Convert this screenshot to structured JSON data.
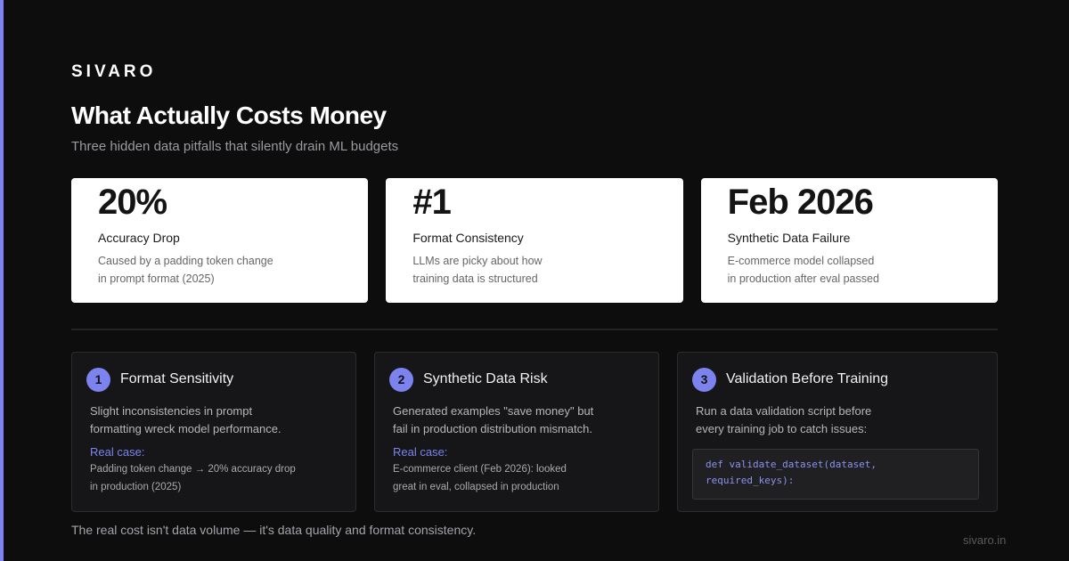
{
  "brand": "SIVARO",
  "title": "What Actually Costs Money",
  "subtitle": "Three hidden data pitfalls that silently drain ML budgets",
  "colors": {
    "background": "#0d0d0e",
    "accent": "#7c83ee",
    "card": "#ffffff"
  },
  "stats": [
    {
      "value": "20%",
      "label": "Accuracy Drop",
      "desc_line1": "Caused by a padding token change",
      "desc_line2": "in prompt format (2025)"
    },
    {
      "value": "#1",
      "label": "Format Consistency",
      "desc_line1": "LLMs are picky about how",
      "desc_line2": "training data is structured"
    },
    {
      "value": "Feb 2026",
      "label": "Synthetic Data Failure",
      "desc_line1": "E-commerce model collapsed",
      "desc_line2": "in production after eval passed"
    }
  ],
  "tips": [
    {
      "number": "1",
      "title": "Format Sensitivity",
      "body_line1": "Slight inconsistencies in prompt",
      "body_line2": "formatting wreck model performance.",
      "case_label": "Real case:",
      "case_line1": "Padding token change → 20% accuracy drop",
      "case_line2": "in production (2025)"
    },
    {
      "number": "2",
      "title": "Synthetic Data Risk",
      "body_line1": "Generated examples \"save money\" but",
      "body_line2": "fail in production distribution mismatch.",
      "case_label": "Real case:",
      "case_line1": "E-commerce client (Feb 2026): looked",
      "case_line2": "great in eval, collapsed in production"
    },
    {
      "number": "3",
      "title": "Validation Before Training",
      "body_line1": "Run a data validation script before",
      "body_line2": "every training job to catch issues:",
      "code_line1": "def validate_dataset(dataset,",
      "code_line2": "required_keys):"
    }
  ],
  "footer_note": "The real cost isn't data volume — it's data quality and format consistency.",
  "footer_url": "sivaro.in"
}
